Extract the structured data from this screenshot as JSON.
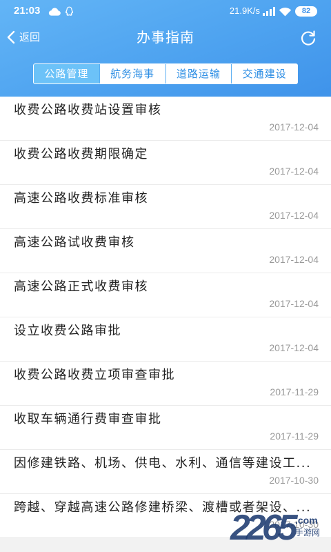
{
  "status_bar": {
    "time": "21:03",
    "net_speed": "21.9K/s",
    "battery_level": "82",
    "icons": [
      "cloud-icon",
      "qq-icon",
      "signal-icon",
      "wifi-icon",
      "battery-icon"
    ]
  },
  "header": {
    "back_label": "返回",
    "title": "办事指南",
    "icons": [
      "chevron-left-icon",
      "refresh-icon"
    ]
  },
  "tabs": [
    {
      "label": "公路管理",
      "selected": true
    },
    {
      "label": "航务海事",
      "selected": false
    },
    {
      "label": "道路运输",
      "selected": false
    },
    {
      "label": "交通建设",
      "selected": false
    }
  ],
  "list": [
    {
      "title": "收费公路收费站设置审核",
      "date": "2017-12-04"
    },
    {
      "title": "收费公路收费期限确定",
      "date": "2017-12-04"
    },
    {
      "title": "高速公路收费标准审核",
      "date": "2017-12-04"
    },
    {
      "title": "高速公路试收费审核",
      "date": "2017-12-04"
    },
    {
      "title": "高速公路正式收费审核",
      "date": "2017-12-04"
    },
    {
      "title": "设立收费公路审批",
      "date": "2017-12-04"
    },
    {
      "title": "收费公路收费立项审查审批",
      "date": "2017-11-29"
    },
    {
      "title": "收取车辆通行费审查审批",
      "date": "2017-11-29"
    },
    {
      "title": "因修建铁路、机场、供电、水利、通信等建设工...",
      "date": "2017-10-30"
    },
    {
      "title": "跨越、穿越高速公路修建桥梁、渡槽或者架设、...",
      "date": "2017-10-30"
    }
  ],
  "watermark": {
    "number": "2265",
    "domain": ".com",
    "name": "手游网"
  },
  "colors": {
    "header_light": "#63b5f6",
    "header_dark": "#3f93ea",
    "tab_selected_bg": "#6cc2f8",
    "tab_text": "#2b8de4",
    "title_text": "#222222",
    "date_text": "#999999",
    "divider": "#ebebeb"
  }
}
